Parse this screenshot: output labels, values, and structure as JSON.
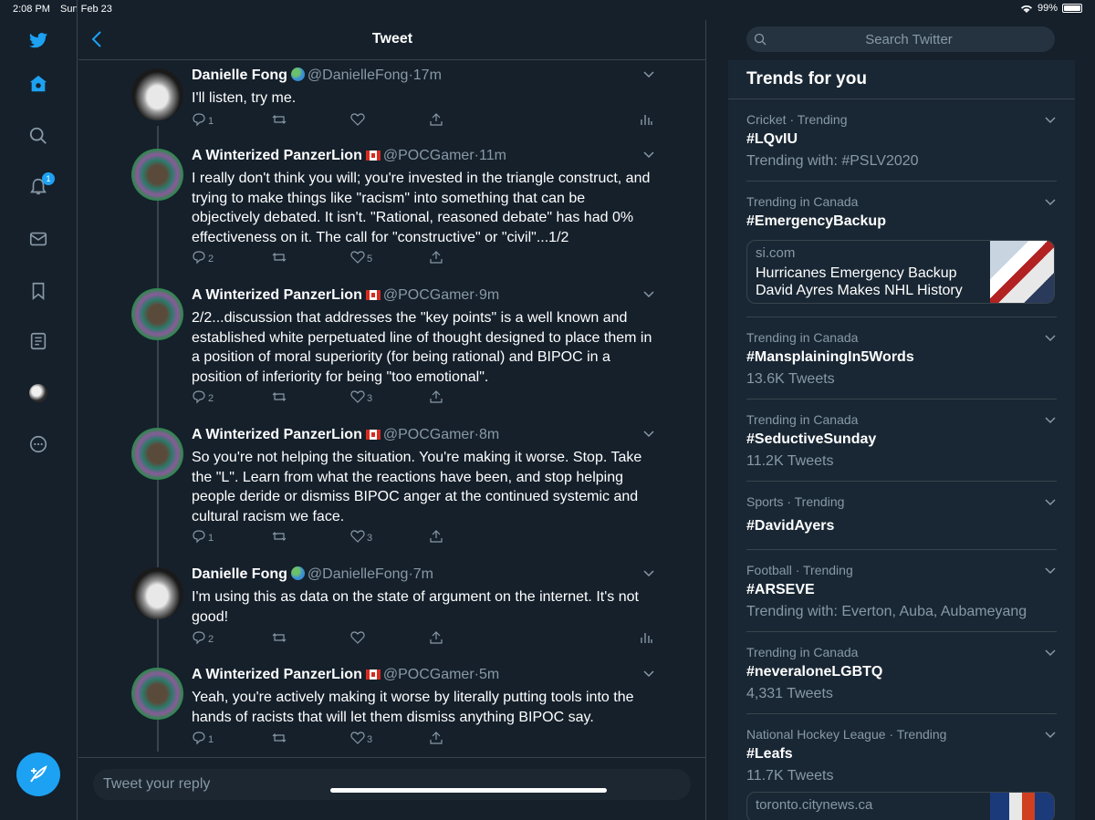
{
  "status_bar": {
    "time": "2:08 PM",
    "date": "Sun Feb 23",
    "battery": "99%"
  },
  "nav": {
    "items": [
      {
        "name": "twitter-logo",
        "icon": "bird-icon"
      },
      {
        "name": "home",
        "icon": "home-icon"
      },
      {
        "name": "explore",
        "icon": "search-icon"
      },
      {
        "name": "notifications",
        "icon": "bell-icon",
        "badge": "1"
      },
      {
        "name": "messages",
        "icon": "mail-icon"
      },
      {
        "name": "bookmarks",
        "icon": "bookmark-icon"
      },
      {
        "name": "lists",
        "icon": "list-icon"
      },
      {
        "name": "profile",
        "icon": "avatar"
      },
      {
        "name": "more",
        "icon": "more-icon"
      }
    ],
    "accent": "#1da1f2"
  },
  "header": {
    "title": "Tweet"
  },
  "tweets": [
    {
      "name": "Danielle Fong",
      "emoji": "globe",
      "handle": "@DanielleFong",
      "time": "17m",
      "text": "I'll listen, try me.",
      "replies": "1",
      "retweets": "",
      "likes": "",
      "analytics": true
    },
    {
      "name": "A Winterized PanzerLion",
      "emoji": "canada-flag",
      "handle": "@POCGamer",
      "time": "11m",
      "text": "I really don't think you will; you're invested in the triangle construct, and trying to make things like \"racism\" into something that can be objectively debated. It isn't. \"Rational, reasoned debate\" has had 0% effectiveness on it. The call for \"constructive\" or \"civil\"...1/2",
      "replies": "2",
      "retweets": "",
      "likes": "5",
      "analytics": false
    },
    {
      "name": "A Winterized PanzerLion",
      "emoji": "canada-flag",
      "handle": "@POCGamer",
      "time": "9m",
      "text": "2/2...discussion that addresses the \"key points\" is a well known and established white perpetuated line of thought designed to place them in a position of moral superiority (for being rational) and BIPOC in a position of inferiority for being \"too emotional\".",
      "replies": "2",
      "retweets": "",
      "likes": "3",
      "analytics": false
    },
    {
      "name": "A Winterized PanzerLion",
      "emoji": "canada-flag",
      "handle": "@POCGamer",
      "time": "8m",
      "text": "So you're not helping the situation. You're making it worse. Stop. Take the \"L\". Learn from what the reactions have been, and stop helping people deride or dismiss BIPOC anger at the continued systemic and cultural racism we face.",
      "replies": "1",
      "retweets": "",
      "likes": "3",
      "analytics": false
    },
    {
      "name": "Danielle Fong",
      "emoji": "globe",
      "handle": "@DanielleFong",
      "time": "7m",
      "text": "I'm using this as data on the state of argument on the internet. It's not good!",
      "replies": "2",
      "retweets": "",
      "likes": "",
      "analytics": true
    },
    {
      "name": "A Winterized PanzerLion",
      "emoji": "canada-flag",
      "handle": "@POCGamer",
      "time": "5m",
      "text": "Yeah, you're actively making it worse by literally putting tools into the hands of racists that will let them dismiss anything BIPOC say.",
      "replies": "1",
      "retweets": "",
      "likes": "3",
      "analytics": false
    }
  ],
  "reply": {
    "placeholder": "Tweet your reply"
  },
  "search": {
    "placeholder": "Search Twitter"
  },
  "trends": {
    "title": "Trends for you",
    "items": [
      {
        "meta": "Cricket · Trending",
        "tag": "#LQvIU",
        "sub": "Trending with: #PSLV2020"
      },
      {
        "meta": "Trending in Canada",
        "tag": "#EmergencyBackup",
        "card": {
          "source": "si.com",
          "headline": "Hurricanes Emergency Backup David Ayres Makes NHL History"
        }
      },
      {
        "meta": "Trending in Canada",
        "tag": "#MansplainingIn5Words",
        "sub": "13.6K Tweets"
      },
      {
        "meta": "Trending in Canada",
        "tag": "#SeductiveSunday",
        "sub": "11.2K Tweets"
      },
      {
        "meta": "Sports · Trending",
        "tag": "#DavidAyers"
      },
      {
        "meta": "Football · Trending",
        "tag": "#ARSEVE",
        "sub": "Trending with: Everton, Auba, Aubameyang"
      },
      {
        "meta": "Trending in Canada",
        "tag": "#neveraloneLGBTQ",
        "sub": "4,331 Tweets"
      },
      {
        "meta": "National Hockey League · Trending",
        "tag": "#Leafs",
        "sub": "11.7K Tweets",
        "card": {
          "source": "toronto.citynews.ca"
        }
      }
    ]
  }
}
